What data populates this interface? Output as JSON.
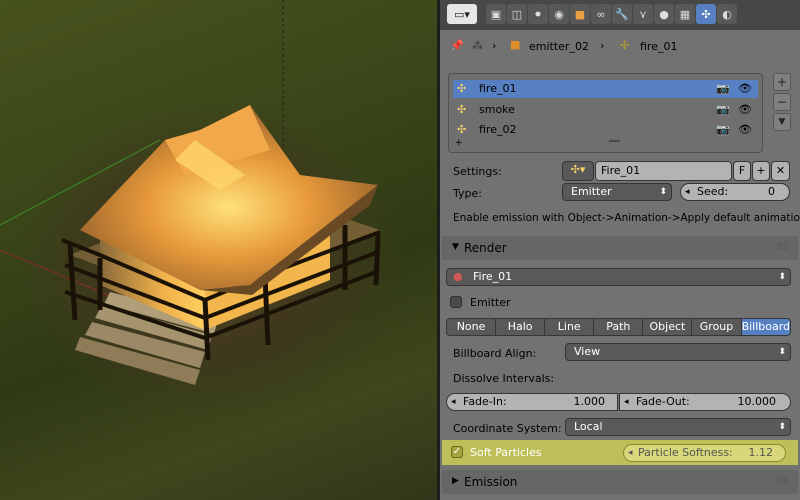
{
  "colors": {
    "accent": "#5680c2",
    "highlight_row": "#bfbf5a",
    "panel_bg": "#727272"
  },
  "header": {
    "editor_icon": "properties-editor-icon",
    "tabs": [
      "render-icon",
      "render-layers-icon",
      "scene-icon",
      "world-icon",
      "object-icon",
      "constraints-icon",
      "modifiers-icon",
      "material-icon",
      "texture-icon",
      "particles-icon",
      "physics-icon"
    ],
    "active_tab": "particles-icon"
  },
  "breadcrumb": {
    "object": "emitter_02",
    "particle_system": "fire_01"
  },
  "particle_list": {
    "items": [
      {
        "name": "fire_01",
        "selected": true
      },
      {
        "name": "smoke",
        "selected": false
      },
      {
        "name": "fire_02",
        "selected": false
      }
    ]
  },
  "settings": {
    "label": "Settings:",
    "value": "Fire_01",
    "fake_user": "F",
    "type_label": "Type:",
    "type_value": "Emitter",
    "seed_label": "Seed:",
    "seed_value": "0",
    "hint": "Enable emission with Object->Animation->Apply default animation."
  },
  "render": {
    "title": "Render",
    "material": "Fire_01",
    "emitter_label": "Emitter",
    "emitter_checked": false,
    "render_types": [
      "None",
      "Halo",
      "Line",
      "Path",
      "Object",
      "Group",
      "Billboard"
    ],
    "active_render_type": "Billboard",
    "billboard_align_label": "Billboard Align:",
    "billboard_align_value": "View",
    "dissolve_label": "Dissolve Intervals:",
    "fade_in_label": "Fade-In:",
    "fade_in_value": "1.000",
    "fade_out_label": "Fade-Out:",
    "fade_out_value": "10.000",
    "coord_system_label": "Coordinate System:",
    "coord_system_value": "Local",
    "soft_particles_label": "Soft Particles",
    "soft_particles_checked": true,
    "particle_softness_label": "Particle Softness:",
    "particle_softness_value": "1.12"
  },
  "emission": {
    "title": "Emission"
  }
}
